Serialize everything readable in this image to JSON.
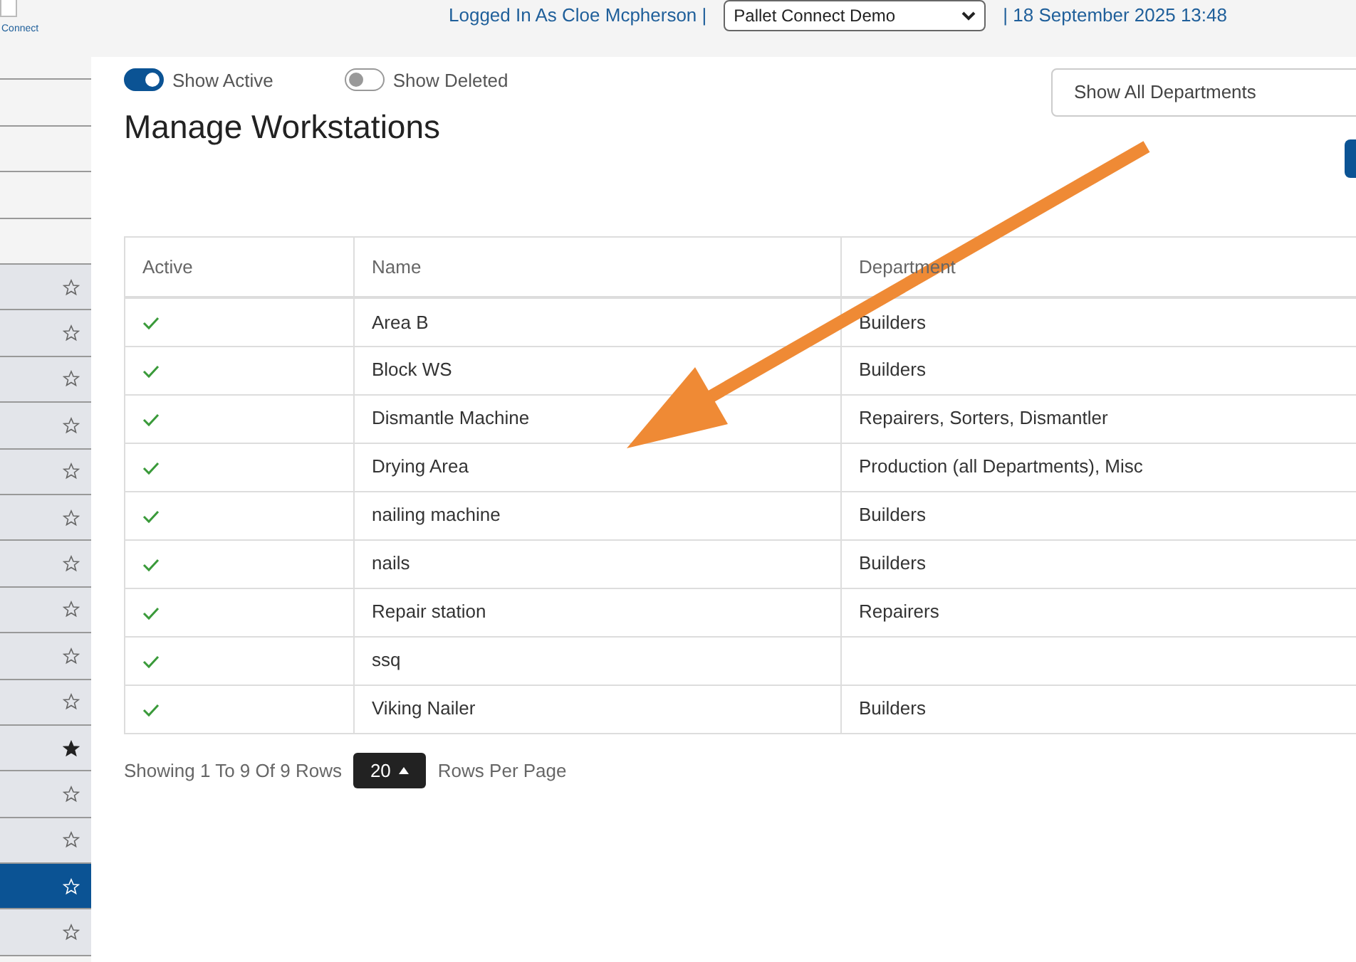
{
  "header": {
    "logo_text": "Connect",
    "user": "Logged In As Cloe Mcpherson |",
    "company": "Pallet Connect Demo",
    "date": "| 18 September 2025 13:48"
  },
  "sidebar": {
    "items": [
      {
        "favorite": false,
        "selected": false
      },
      {
        "favorite": false,
        "selected": false
      },
      {
        "favorite": false,
        "selected": false
      },
      {
        "favorite": false,
        "selected": false
      },
      {
        "favorite": false,
        "selected": false
      },
      {
        "favorite": false,
        "selected": false
      },
      {
        "favorite": false,
        "selected": false
      },
      {
        "favorite": false,
        "selected": false
      },
      {
        "favorite": false,
        "selected": false
      },
      {
        "favorite": false,
        "selected": false
      },
      {
        "favorite": true,
        "selected": false
      },
      {
        "favorite": false,
        "selected": false
      },
      {
        "favorite": false,
        "selected": false
      },
      {
        "favorite": false,
        "selected": true
      },
      {
        "favorite": false,
        "selected": false
      }
    ]
  },
  "toggles": [
    {
      "label": "Show Active",
      "on": true
    },
    {
      "label": "Show Deleted",
      "on": false
    }
  ],
  "department_filter": "Show All Departments",
  "title": "Manage Workstations",
  "table": {
    "columns": [
      "Active",
      "Name",
      "Department"
    ],
    "rows": [
      {
        "active": true,
        "name": "Area B",
        "department": "Builders"
      },
      {
        "active": true,
        "name": "Block WS",
        "department": "Builders"
      },
      {
        "active": true,
        "name": "Dismantle Machine",
        "department": "Repairers, Sorters, Dismantler"
      },
      {
        "active": true,
        "name": "Drying Area",
        "department": "Production (all Departments), Misc"
      },
      {
        "active": true,
        "name": "nailing machine",
        "department": "Builders"
      },
      {
        "active": true,
        "name": "nails",
        "department": "Builders"
      },
      {
        "active": true,
        "name": "Repair station",
        "department": "Repairers"
      },
      {
        "active": true,
        "name": "ssq",
        "department": ""
      },
      {
        "active": true,
        "name": "Viking Nailer",
        "department": "Builders"
      }
    ]
  },
  "pagination": {
    "summary": "Showing 1 To 9 Of 9 Rows",
    "page_size": "20",
    "suffix": "Rows Per Page"
  }
}
